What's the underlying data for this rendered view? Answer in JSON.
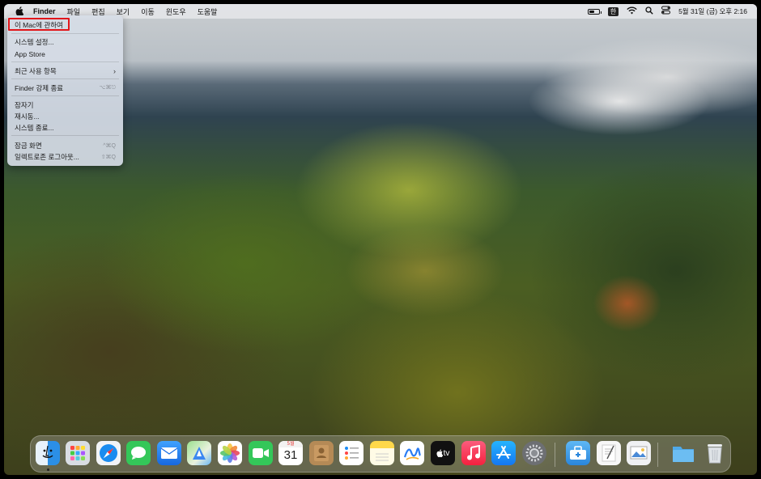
{
  "menubar": {
    "apple_icon": "apple-logo-icon",
    "app_name": "Finder",
    "items": [
      "파일",
      "편집",
      "보기",
      "이동",
      "윈도우",
      "도움말"
    ],
    "battery_level": 0.55,
    "input_method": "한",
    "clock": "5월 31일 (금) 오후 2:16"
  },
  "apple_menu": {
    "about": "이 Mac에 관하여",
    "system_settings": "시스템 설정...",
    "app_store": "App Store",
    "recent_items": "최근 사용 항목",
    "force_quit": "Finder 강제 종료",
    "force_quit_shortcut": "⌥⌘⎋",
    "sleep": "잠자기",
    "restart": "재시동...",
    "shutdown": "시스템 종료...",
    "lock_screen": "잠금 화면",
    "lock_screen_shortcut": "^⌘Q",
    "logout": "일렉트로존 로그아웃...",
    "logout_shortcut": "⇧⌘Q",
    "highlight_color": "#e2161a"
  },
  "dock": {
    "calendar_month": "5월",
    "calendar_day": "31",
    "apple_tv_label": "tv",
    "apps": [
      "finder",
      "launchpad",
      "safari",
      "messages",
      "mail",
      "maps",
      "photos",
      "facetime",
      "calendar",
      "contacts",
      "reminders",
      "notes",
      "freeform",
      "apple-tv",
      "music",
      "app-store",
      "system-settings",
      "toolbox",
      "textedit",
      "preview",
      "downloads-folder",
      "trash"
    ]
  }
}
